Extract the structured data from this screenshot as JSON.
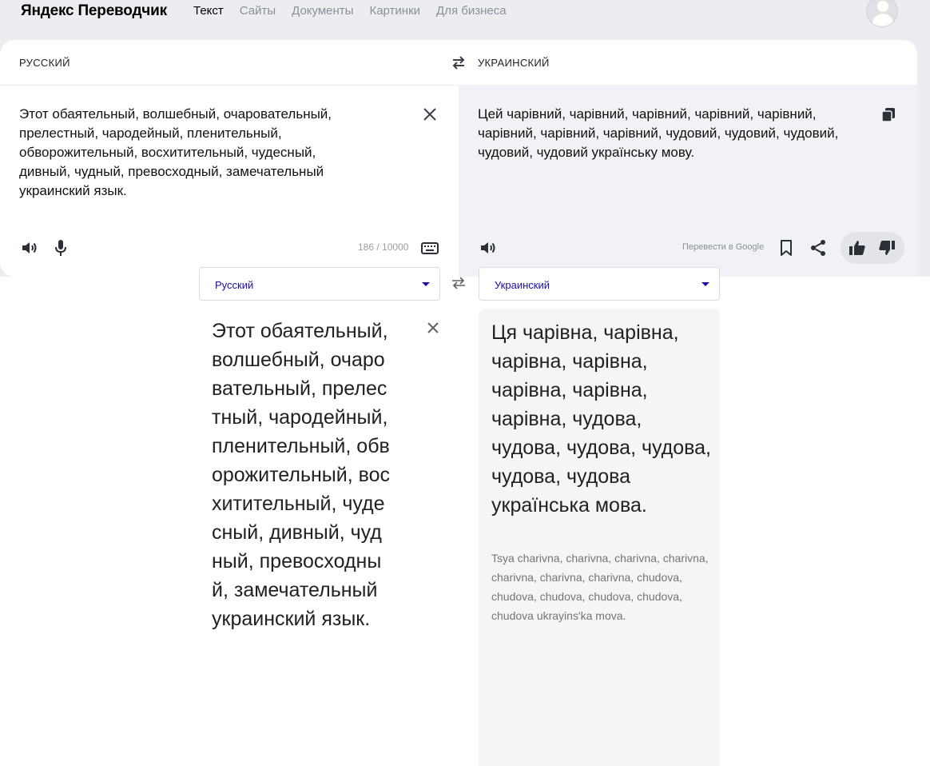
{
  "yandex": {
    "logo": "Яндекс Переводчик",
    "nav": [
      "Текст",
      "Сайты",
      "Документы",
      "Картинки",
      "Для бизнеса"
    ],
    "active_nav": "Текст",
    "source_lang": "РУССКИЙ",
    "target_lang": "УКРАИНСКИЙ",
    "source_text": "Этот обаятельный, волшебный, очаровательный, прелестный, чародейный, пленительный, обворожительный, восхитительный, чудесный, дивный, чудный, превосходный, замечательный украинский язык.",
    "translation": "Цей чарівний, чарівний, чарівний, чарівний, чарівний, чарівний, чарівний, чарівний, чудовий, чудовий, чудовий, чудовий, чудовий українську мову.",
    "char_count": "186 / 10000",
    "google_link": "Перевести в Google",
    "icons": [
      "speaker-icon",
      "microphone-icon",
      "keyboard-icon",
      "copy-icon",
      "bookmark-icon",
      "share-icon",
      "thumbs-up-icon",
      "thumbs-down-icon",
      "close-icon",
      "swap-icon"
    ]
  },
  "google": {
    "source_lang": "Русский",
    "target_lang": "Украинский",
    "source_text": "Этот обаятельный, волшебный, очаровательный, прелестный, чародейный, пленительный, обворожительный, восхитительный, чудесный, дивный, чудный, превосходный, замечательный украинский язык.",
    "translation": "Ця чарівна, чарівна, чарівна, чарівна, чарівна, чарівна, чарівна, чудова, чудова, чудова, чудова, чудова, чудова українська мова.",
    "transliteration": "Tsya charivna, charivna, charivna, charivna, charivna, charivna, charivna, chudova, chudova, chudova, chudova, chudova, chudova ukrayins'ka mova."
  },
  "colors": {
    "page_bg": "#ebedf1",
    "panel_bg": "#f1f2f5",
    "google_link": "#1a0dab",
    "muted": "#8a8f99"
  }
}
